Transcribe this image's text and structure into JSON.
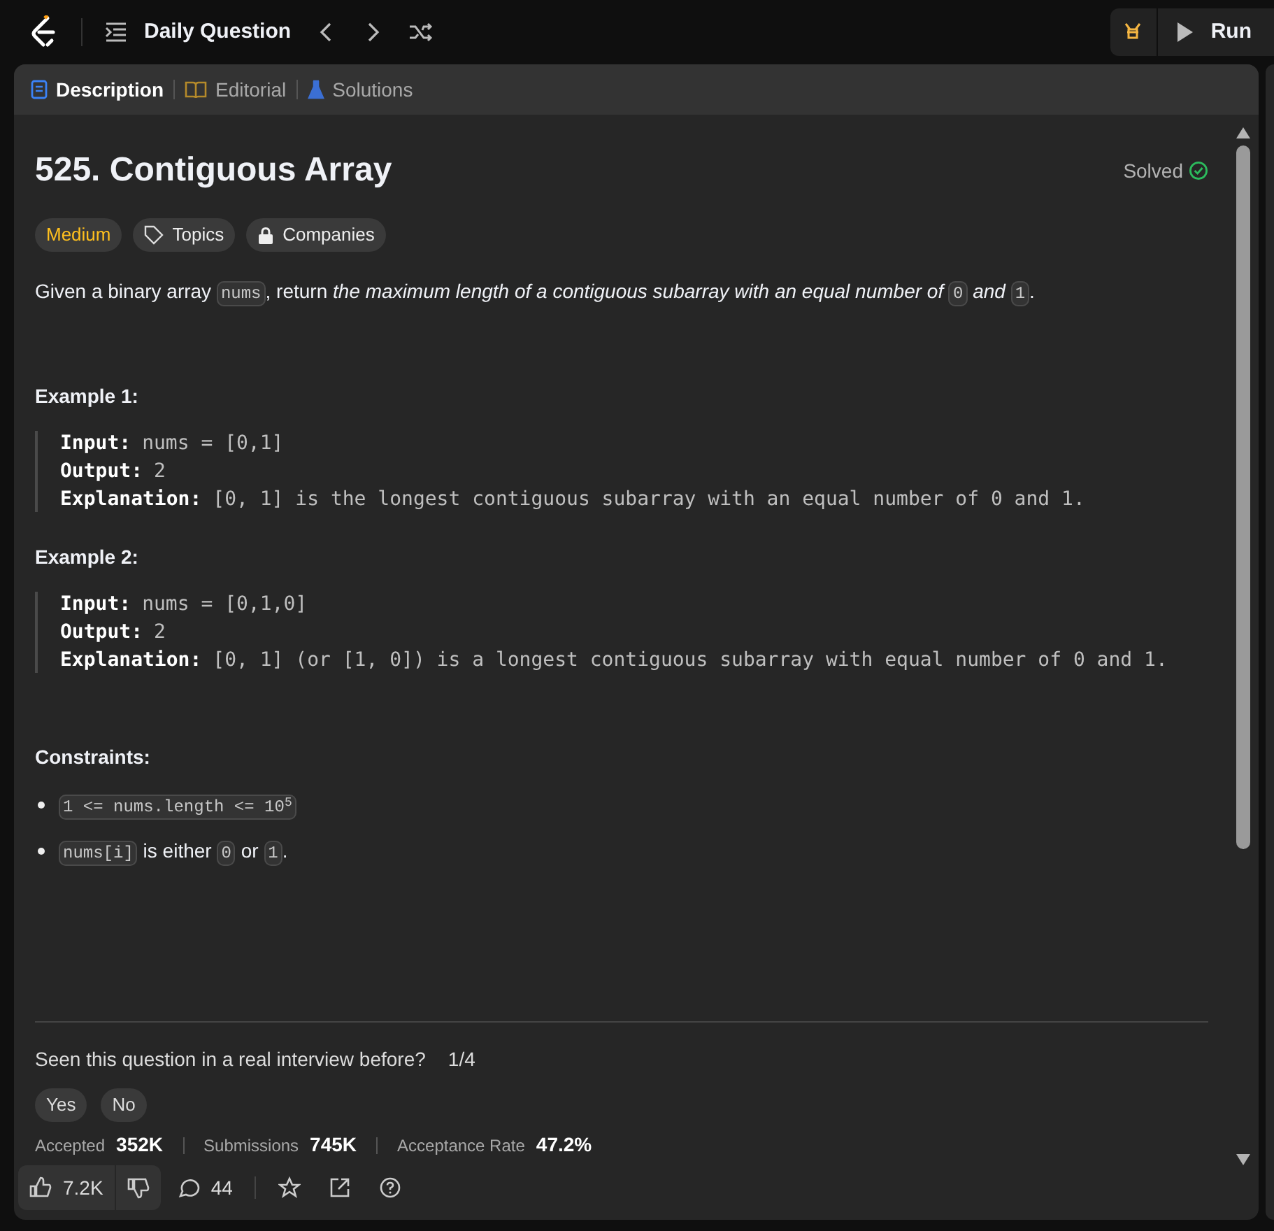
{
  "topbar": {
    "title": "Daily Question",
    "run_label": "Run"
  },
  "tabs": [
    {
      "label": "Description",
      "selected": true
    },
    {
      "label": "Editorial",
      "selected": false
    },
    {
      "label": "Solutions",
      "selected": false
    }
  ],
  "problem": {
    "title": "525. Contiguous Array",
    "status": "Solved",
    "solved": true,
    "tags": [
      {
        "label": "Medium",
        "kind": "difficulty"
      },
      {
        "label": "Topics",
        "kind": "topics"
      },
      {
        "label": "Companies",
        "kind": "companies"
      }
    ],
    "description": [
      {
        "kind": "text",
        "text": "Given a binary array "
      },
      {
        "kind": "code",
        "text": "nums"
      },
      {
        "kind": "text",
        "text": ", return "
      },
      {
        "kind": "italic",
        "text": "the maximum length of a contiguous subarray with an equal number of "
      },
      {
        "kind": "code",
        "text": "0"
      },
      {
        "kind": "italic",
        "text": " and "
      },
      {
        "kind": "code",
        "text": "1"
      },
      {
        "kind": "text",
        "text": "."
      }
    ],
    "examples": [
      {
        "title": "Example 1:",
        "lines": [
          {
            "label": "Input:",
            "value": "nums = [0,1]"
          },
          {
            "label": "Output:",
            "value": "2"
          },
          {
            "label": "Explanation:",
            "value": "[0, 1] is the longest contiguous subarray with an equal number of 0 and 1."
          }
        ]
      },
      {
        "title": "Example 2:",
        "lines": [
          {
            "label": "Input:",
            "value": "nums = [0,1,0]"
          },
          {
            "label": "Output:",
            "value": "2"
          },
          {
            "label": "Explanation:",
            "value": "[0, 1] (or [1, 0]) is a longest contiguous subarray with equal number of 0 and 1."
          }
        ]
      }
    ],
    "constraints_title": "Constraints:",
    "constraints": [
      [
        {
          "kind": "code",
          "text": "1 <= nums.length <= 10$^{5}$"
        }
      ],
      [
        {
          "kind": "code",
          "text": "nums[i]"
        },
        {
          "kind": "text",
          "text": " is either "
        },
        {
          "kind": "code",
          "text": "0"
        },
        {
          "kind": "text",
          "text": " or "
        },
        {
          "kind": "code",
          "text": "1"
        },
        {
          "kind": "text",
          "text": "."
        }
      ]
    ]
  },
  "interview": {
    "question": "Seen this question in a real interview before?",
    "count": "1/4",
    "answers": [
      "Yes",
      "No"
    ]
  },
  "stats": [
    {
      "label": "Accepted",
      "value": "352K"
    },
    {
      "label": "Submissions",
      "value": "745K"
    },
    {
      "label": "Acceptance Rate",
      "value": "47.2%"
    }
  ],
  "footer": {
    "likes": "7.2K",
    "comments": "44"
  }
}
